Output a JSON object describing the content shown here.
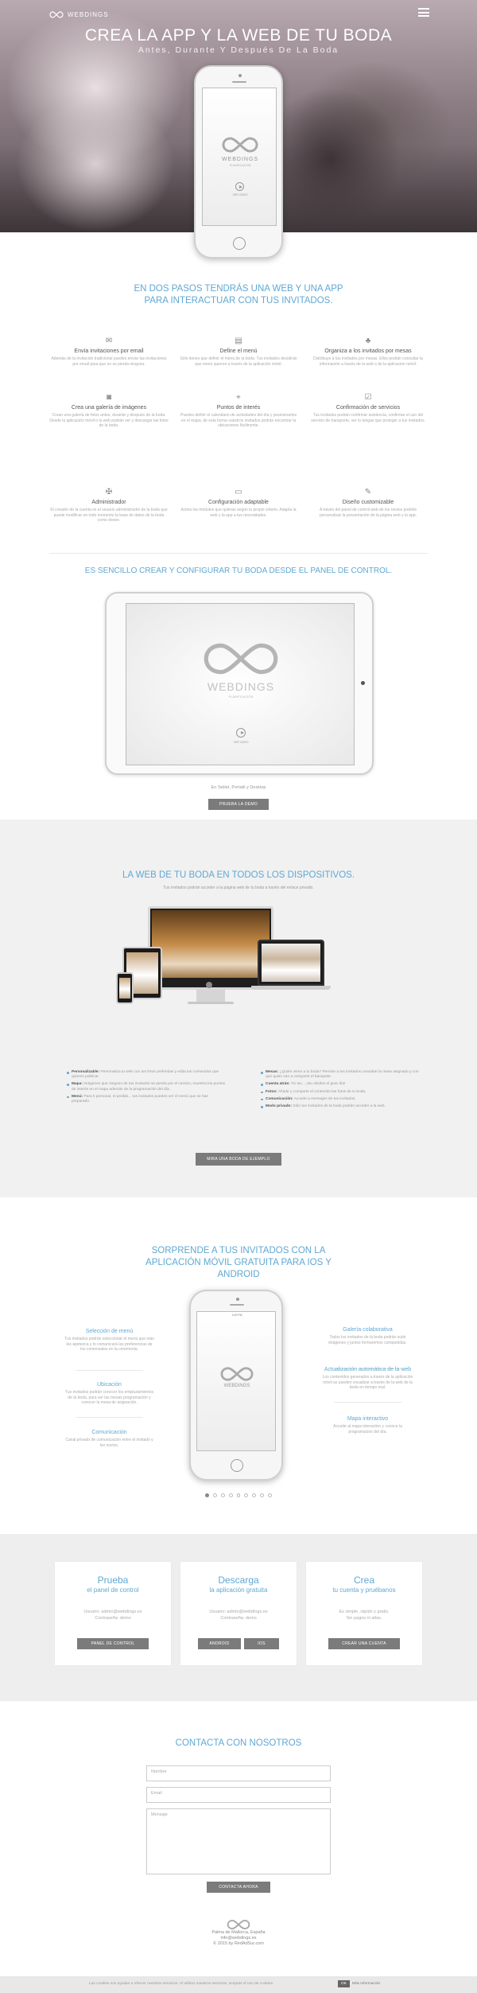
{
  "header": {
    "brand": "WEBDINGS",
    "title": "CREA LA APP Y LA WEB DE TU BODA",
    "subtitle": "Antes, Durante Y Después De La Boda"
  },
  "phone_screen": {
    "brand": "WEBDINGS",
    "brand_sub": "PLANIFICACIÓN",
    "play_label": "VER VIDEO"
  },
  "section1": {
    "title_line1": "EN DOS PASOS TENDRÁS UNA WEB Y UNA APP",
    "title_line2": "PARA INTERACTUAR CON TUS INVITADOS.",
    "features": [
      {
        "icon": "envelope-icon",
        "title": "Envía invitaciones por email",
        "desc": "Además de la invitación tradicional puedes enviar las invitaciones por email para que no se pierda ninguna."
      },
      {
        "icon": "menu-card-icon",
        "title": "Define el menú",
        "desc": "Sólo tienes que definir el menú de la boda. Tus invitados decidirán que menú quieren a través de la aplicación móvil."
      },
      {
        "icon": "table-icon",
        "title": "Organiza a los invitados por mesas",
        "desc": "Distribuye a tus invitados por mesas. Ellos podrán consultar la información a través de la web o de la aplicación móvil."
      },
      {
        "icon": "camera-icon",
        "title": "Crea una galería de imágenes",
        "desc": "Crean una galería de fotos antes, durante y después de la boda. Desde la aplicación móvil o la web podrán ver y descargar las fotos de la boda."
      },
      {
        "icon": "pin-icon",
        "title": "Puntos de interés",
        "desc": "Puedes definir el calendario de actividades del día y posicionarlos en el mapa, de esta forma vuestros invitados podrán encontrar la ubicaciones fácilmente."
      },
      {
        "icon": "check-icon",
        "title": "Confirmación de servicios",
        "desc": "Tus invitados podrán confirmar asistencia, confirmar el uso del servicio de transporte, ver lo tengas que proteger a tus invitados."
      },
      {
        "icon": "tools-icon",
        "title": "Administrador",
        "desc": "El creador de la cuenta es el usuario administrador de la boda que puede modificar en todo momento la base de datos de la boda como desee."
      },
      {
        "icon": "monitor-icon",
        "title": "Configuración adaptable",
        "desc": "Activa los módulos que quieras según tu propio criterio. Adapta la web y la app a tus necesidades."
      },
      {
        "icon": "pencil-icon",
        "title": "Diseño customizable",
        "desc": "A través del panel de control web de los novios podréis personalizar la presentación de la página web y la app."
      }
    ]
  },
  "section2": {
    "title": "ES SENCILLO CREAR Y CONFIGURAR TU BODA DESDE EL PANEL DE CONTROL.",
    "caption": "En Tablet, Portatil y Desktop",
    "button": "PRUEBA LA DEMO"
  },
  "section3": {
    "title": "LA WEB DE TU BODA EN TODOS LOS DISPOSITIVOS.",
    "subtitle": "Tus invitados podrán acceder a la página web de tu boda a través del enlace privado.",
    "left_bullets": [
      {
        "b": "Personalizable:",
        "t": "Personaliza tu web con tus fotos preferidas y edita los contenidos que quieres publicar."
      },
      {
        "b": "Mapa:",
        "t": "Imágenes que ninguno de tus invitados se pierda por el camino, muestra los puntos de interés en el mapa además de la programación del día."
      },
      {
        "b": "Menú:",
        "t": "Para ti personal, el pedido... tus invitados pueden ver el menú que se has preparado."
      }
    ],
    "right_bullets": [
      {
        "b": "Mesas:",
        "t": "¿Quién viene a tu boda? Permite a tus invitados consultar la mesa asignada y con qué quien van a compartir el banquete."
      },
      {
        "b": "Cuenta atrás:",
        "t": "Tic tac... ¡No olvides el gran día!"
      },
      {
        "b": "Fotos:",
        "t": "Añade y comparte el contenido las fotos de tu boda."
      },
      {
        "b": "Comunicación:",
        "t": "Accede a mensajes de tus invitados."
      },
      {
        "b": "Modo privado:",
        "t": "Sólo tus invitados de la boda podrán acceder a la web."
      }
    ],
    "button": "MIRA UNA BODA DE EJEMPLO"
  },
  "section4": {
    "title_line1": "SORPRENDE A TUS INVITADOS CON LA",
    "title_line2": "APLICACIÓN MÓVIL GRATUITA PARA IOS Y",
    "title_line3": "ANDROID",
    "phone_time": "1:00 PM",
    "left": [
      {
        "t": "Selección de menú",
        "d": "Tus invitados podrán seleccionar el menú que más les apetezca y lo comunicará las preferencias de los comensales en la ceremonia."
      },
      {
        "t": "Ubicación",
        "d": "Tus invitados podrán conocer los emplazamientos de la boda, para ver las mesas programación y conocer la mesa de asignación."
      },
      {
        "t": "Comunicación",
        "d": "Canal privado de comunicación entre el invitado y los novios."
      }
    ],
    "right": [
      {
        "t": "Galería colaborativa",
        "d": "Todos los invitados de la boda podrán subir imágenes y juntos formaremos compartidas."
      },
      {
        "t": "Actualización automática de la web",
        "d": "Los contenidos generados a través de la aplicación móvil se pueden visualizar a través de la web de la boda en tiempo real."
      },
      {
        "t": "Mapa interactivo",
        "d": "Accede al mapa interactivo y conoce la programación del día."
      }
    ]
  },
  "section5": {
    "cards": [
      {
        "title": "Prueba",
        "sub": "el panel de control",
        "desc1": "Usuario: admin@webdings.es",
        "desc2": "Contraseña: demo",
        "buttons": [
          "PANEL DE CONTROL"
        ]
      },
      {
        "title": "Descarga",
        "sub": "la aplicación gratuita",
        "desc1": "Usuario: admin@webdings.es",
        "desc2": "Contraseña: demo",
        "buttons": [
          "ANDROID",
          "IOS"
        ]
      },
      {
        "title": "Crea",
        "sub": "tu cuenta y pruébanos",
        "desc1": "Es simple, rápido y gratis.",
        "desc2": "Sin pagos ni altas.",
        "buttons": [
          "CREAR UNA CUENTA"
        ]
      }
    ]
  },
  "contact": {
    "title": "CONTACTA CON NOSOTROS",
    "name_ph": "Nombre",
    "email_ph": "Email",
    "message_ph": "Mensaje",
    "button": "CONTACTA AHORA"
  },
  "footer": {
    "line1": "Palma de Mallorca, España",
    "line2": "info@webdings.es",
    "line3": "© 2015 by RedAdSur.com"
  },
  "cookie": {
    "text": "Las cookies nos ayudan a ofrecer nuestros servicios. Al utilizar nuestros servicios, aceptas el uso de cookies.",
    "ok": "OK",
    "more": "Más información"
  }
}
